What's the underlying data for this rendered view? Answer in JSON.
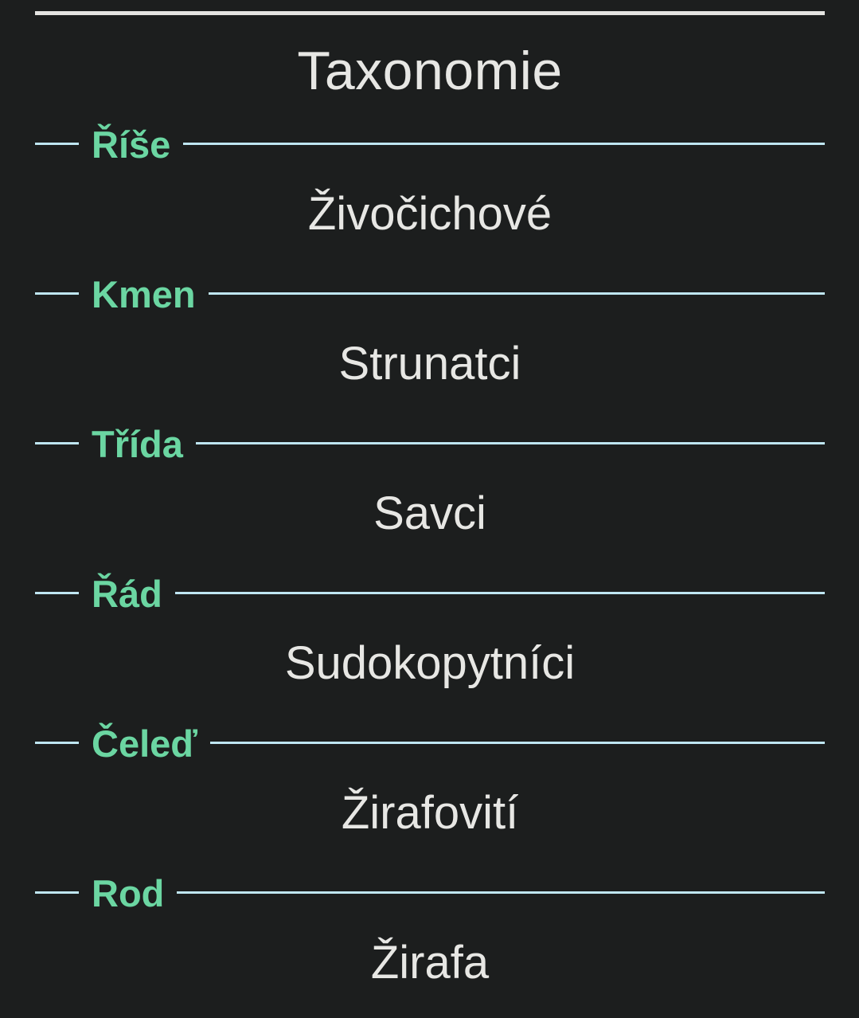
{
  "title": "Taxonomie",
  "colors": {
    "background": "#1c1e1e",
    "heading_text": "#6bd6a2",
    "rule_line": "#bfe6f2",
    "value_text": "#e7e7e4"
  },
  "ranks": [
    {
      "label": "Říše",
      "value": "Živočichové"
    },
    {
      "label": "Kmen",
      "value": "Strunatci"
    },
    {
      "label": "Třída",
      "value": "Savci"
    },
    {
      "label": "Řád",
      "value": "Sudokopytníci"
    },
    {
      "label": "Čeleď",
      "value": "Žirafovití"
    },
    {
      "label": "Rod",
      "value": "Žirafa"
    }
  ]
}
